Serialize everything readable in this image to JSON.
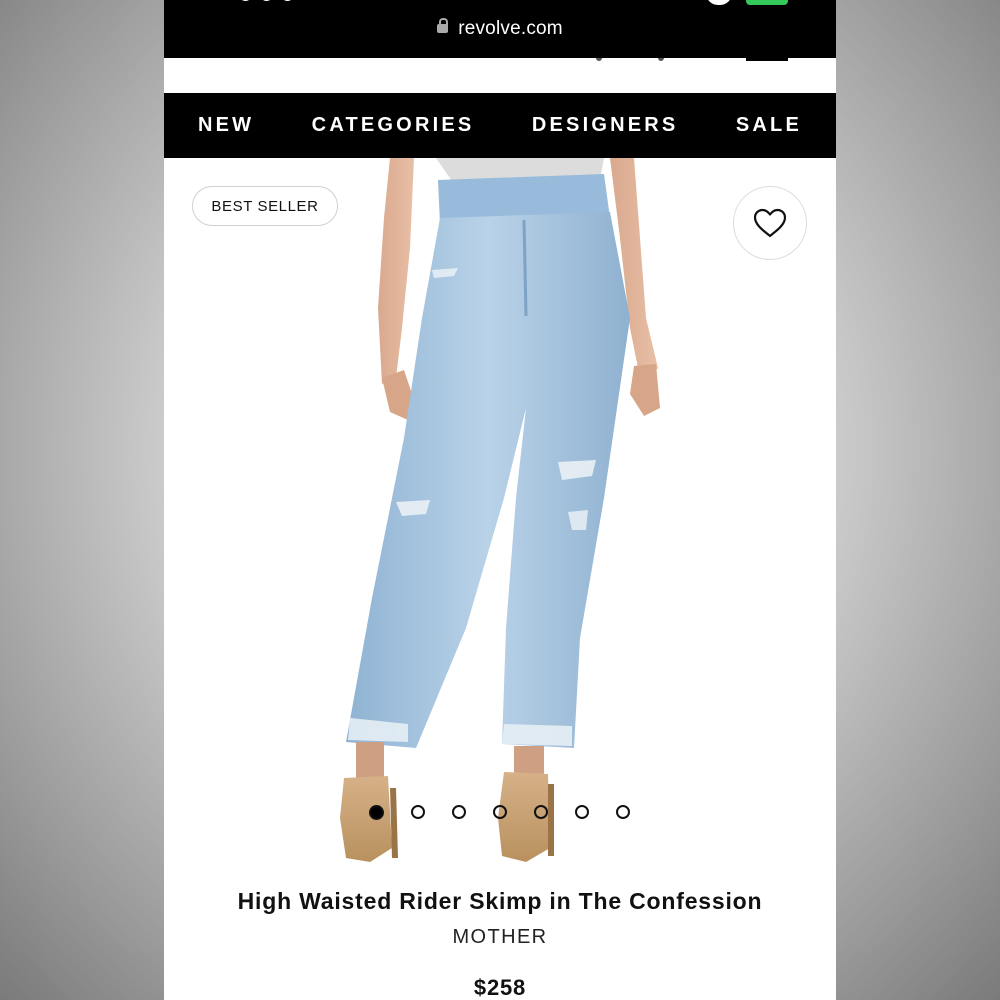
{
  "browser": {
    "url": "revolve.com"
  },
  "nav": {
    "items": [
      "NEW",
      "CATEGORIES",
      "DESIGNERS",
      "SALE"
    ]
  },
  "product": {
    "badge": "BEST SELLER",
    "title": "High Waisted Rider Skimp in The Confession",
    "brand": "MOTHER",
    "price": "$258",
    "image_count": 7,
    "active_image": 1
  },
  "colors": {
    "nav_background": "#000000",
    "denim": "#a9c7e0",
    "heel": "#c8a071",
    "battery": "#34c759"
  },
  "icons": [
    "lock-icon",
    "heart-icon"
  ]
}
